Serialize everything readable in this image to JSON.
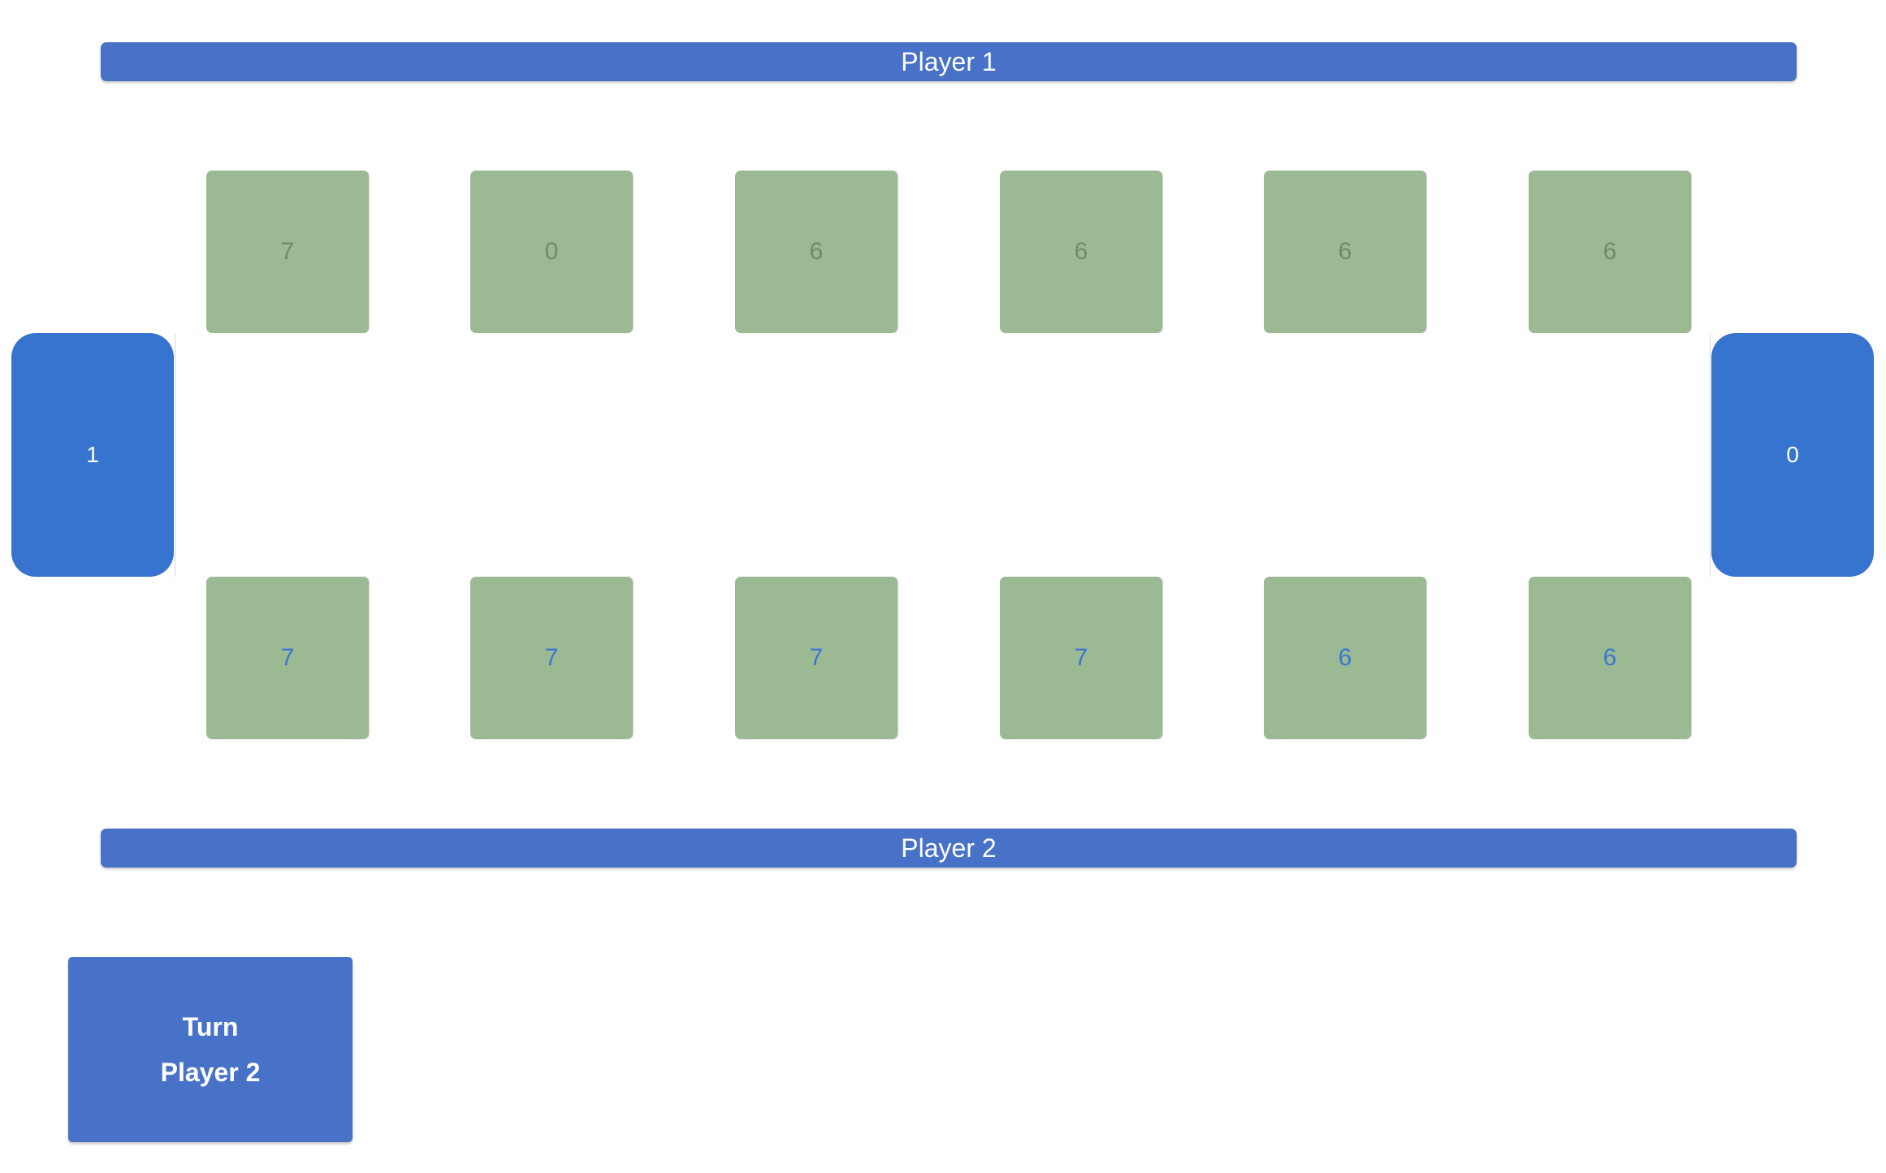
{
  "players": {
    "top_label": "Player 1",
    "bottom_label": "Player 2"
  },
  "stores": {
    "left": "1",
    "right": "0"
  },
  "pits": {
    "player1": [
      "7",
      "0",
      "6",
      "6",
      "6",
      "6"
    ],
    "player2": [
      "7",
      "7",
      "7",
      "7",
      "6",
      "6"
    ]
  },
  "turn": {
    "title": "Turn",
    "player": "Player 2"
  },
  "colors": {
    "banner": "#4772c8",
    "store": "#3774cf",
    "pit": "#9bba93",
    "player1_seed_text": "#6e8c68",
    "player2_seed_text": "#3b77d4"
  }
}
